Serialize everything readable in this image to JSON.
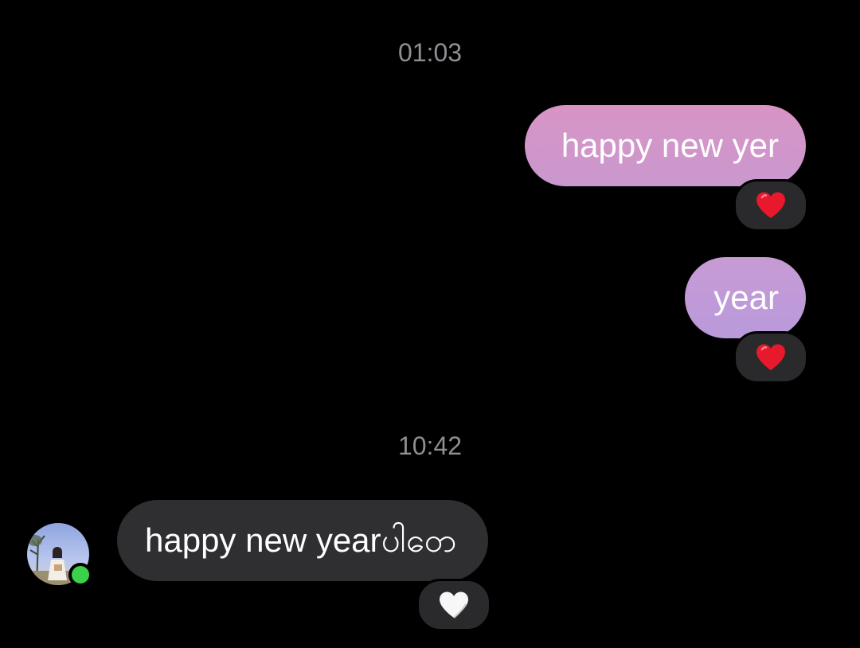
{
  "conversation": {
    "time_separators": [
      "01:03",
      "10:42"
    ],
    "messages": [
      {
        "direction": "outgoing",
        "text": "happy new yer",
        "reaction": "red-heart"
      },
      {
        "direction": "outgoing",
        "text": "year",
        "reaction": "red-heart"
      },
      {
        "direction": "incoming",
        "text": "happy new yearပါဝော",
        "reaction": "white-heart"
      }
    ]
  },
  "contact": {
    "online": true,
    "avatar": "profile-photo"
  },
  "colors": {
    "background": "#000000",
    "timestamp": "#8e8e93",
    "outgoing_bubble_top": "#d895c6",
    "outgoing_bubble_bottom": "#b79ad9",
    "incoming_bubble": "#2f2f31",
    "reaction_pill": "#2a2a2c",
    "red_heart": "#e8192c",
    "online_dot": "#3bd14b"
  }
}
